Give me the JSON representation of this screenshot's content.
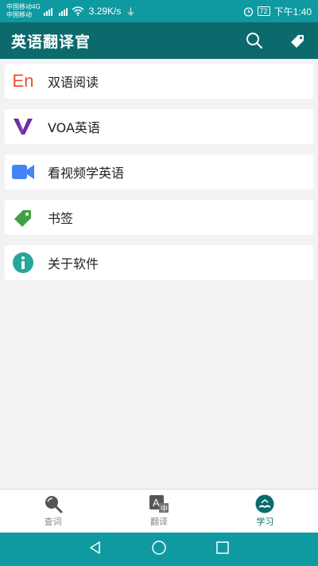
{
  "status_bar": {
    "carrier1": "中国移动4G",
    "carrier2": "中国移动",
    "net_speed": "3.29K/s",
    "battery": "72",
    "time": "下午1:40"
  },
  "app_bar": {
    "title": "英语翻译官",
    "actions": [
      "search-icon",
      "tag-icon"
    ]
  },
  "menu": {
    "items": [
      {
        "label": "双语阅读",
        "icon": "en-icon",
        "icon_text": "En"
      },
      {
        "label": "VOA英语",
        "icon": "voa-icon"
      },
      {
        "label": "看视频学英语",
        "icon": "video-camera-icon"
      },
      {
        "label": "书签",
        "icon": "bookmark-tag-icon"
      },
      {
        "label": "关于软件",
        "icon": "info-icon"
      }
    ]
  },
  "bottom_nav": {
    "items": [
      {
        "label": "查词",
        "icon": "lookup-icon"
      },
      {
        "label": "翻译",
        "icon": "translate-icon"
      },
      {
        "label": "学习",
        "icon": "study-icon",
        "active": true
      }
    ]
  },
  "colors": {
    "status_bar": "#0e9aa0",
    "app_bar": "#0c6a6d",
    "en_orange": "#e8532d",
    "voa_purple": "#6b2fa0",
    "video_blue": "#4285f4",
    "tag_green": "#43a047",
    "info_teal": "#26a69a"
  }
}
